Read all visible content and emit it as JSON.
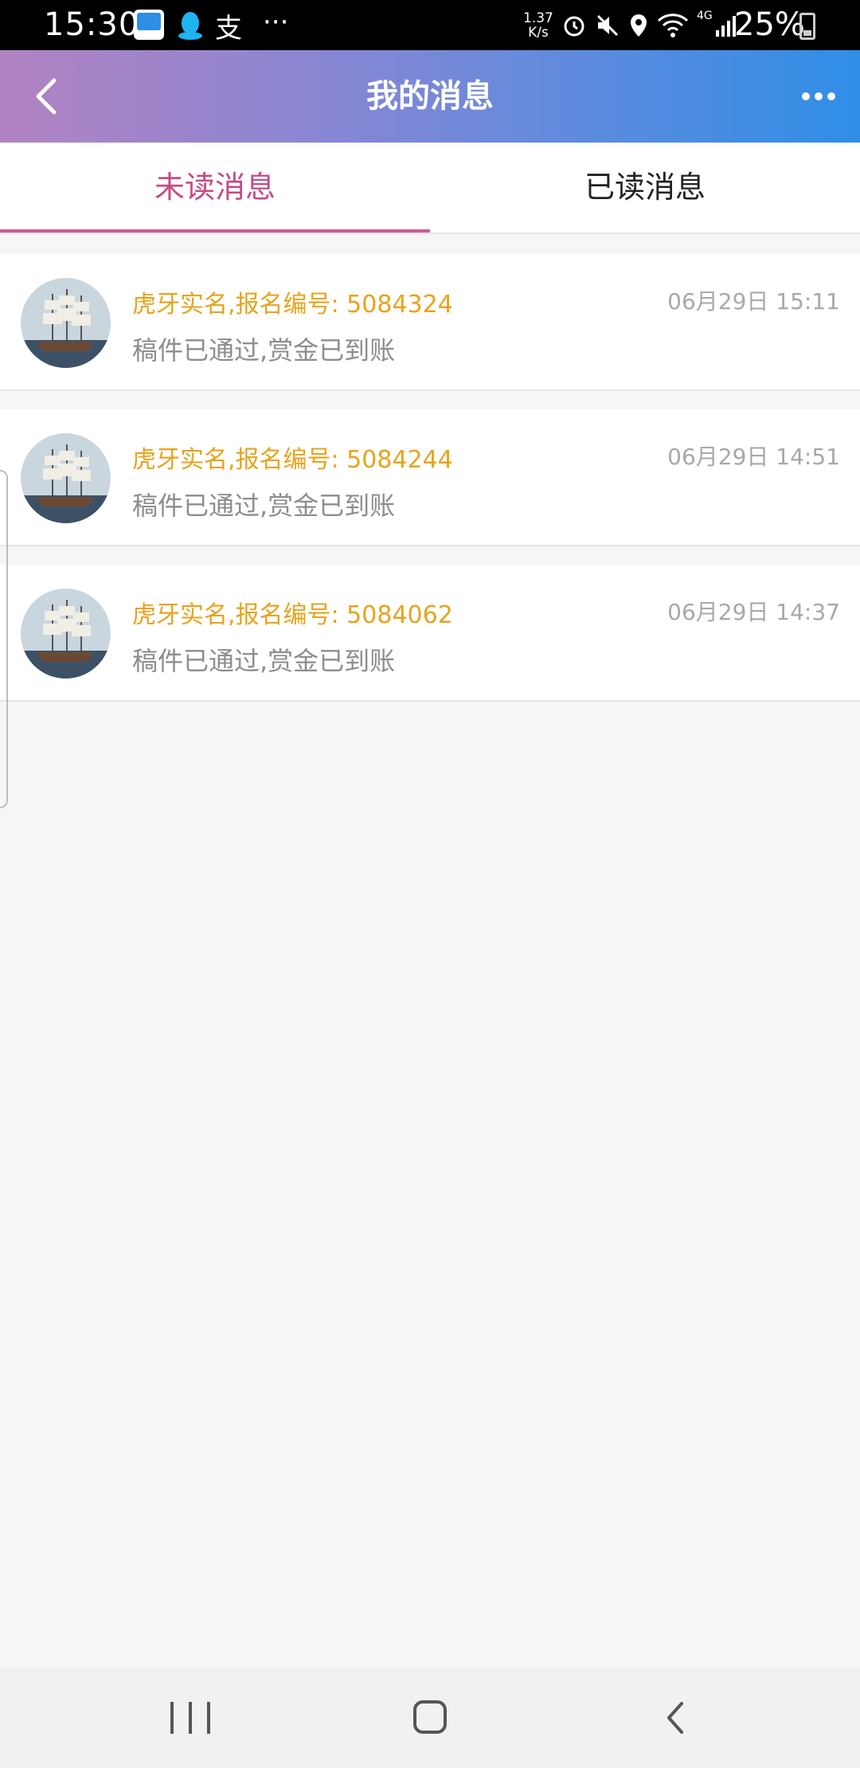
{
  "status_bar": {
    "time": "15:30",
    "app_icons": [
      "speed-app-icon",
      "qq-icon",
      "alipay-icon"
    ],
    "alipay_glyph": "支",
    "more": "···",
    "net_speed_value": "1.37",
    "net_speed_unit": "K/s",
    "network": "4G",
    "battery": "25%"
  },
  "header": {
    "title": "我的消息"
  },
  "tabs": [
    {
      "label": "未读消息",
      "active": true
    },
    {
      "label": "已读消息",
      "active": false
    }
  ],
  "messages": [
    {
      "title": "虎牙实名,报名编号: 5084324",
      "time": "06月29日 15:11",
      "body": "稿件已通过,赏金已到账"
    },
    {
      "title": "虎牙实名,报名编号: 5084244",
      "time": "06月29日 14:51",
      "body": "稿件已通过,赏金已到账"
    },
    {
      "title": "虎牙实名,报名编号: 5084062",
      "time": "06月29日 14:37",
      "body": "稿件已通过,赏金已到账"
    }
  ],
  "colors": {
    "accent": "#c64b83",
    "title_orange": "#e8a31c",
    "header_gradient_start": "#b283c2",
    "header_gradient_end": "#2f8ee6"
  }
}
